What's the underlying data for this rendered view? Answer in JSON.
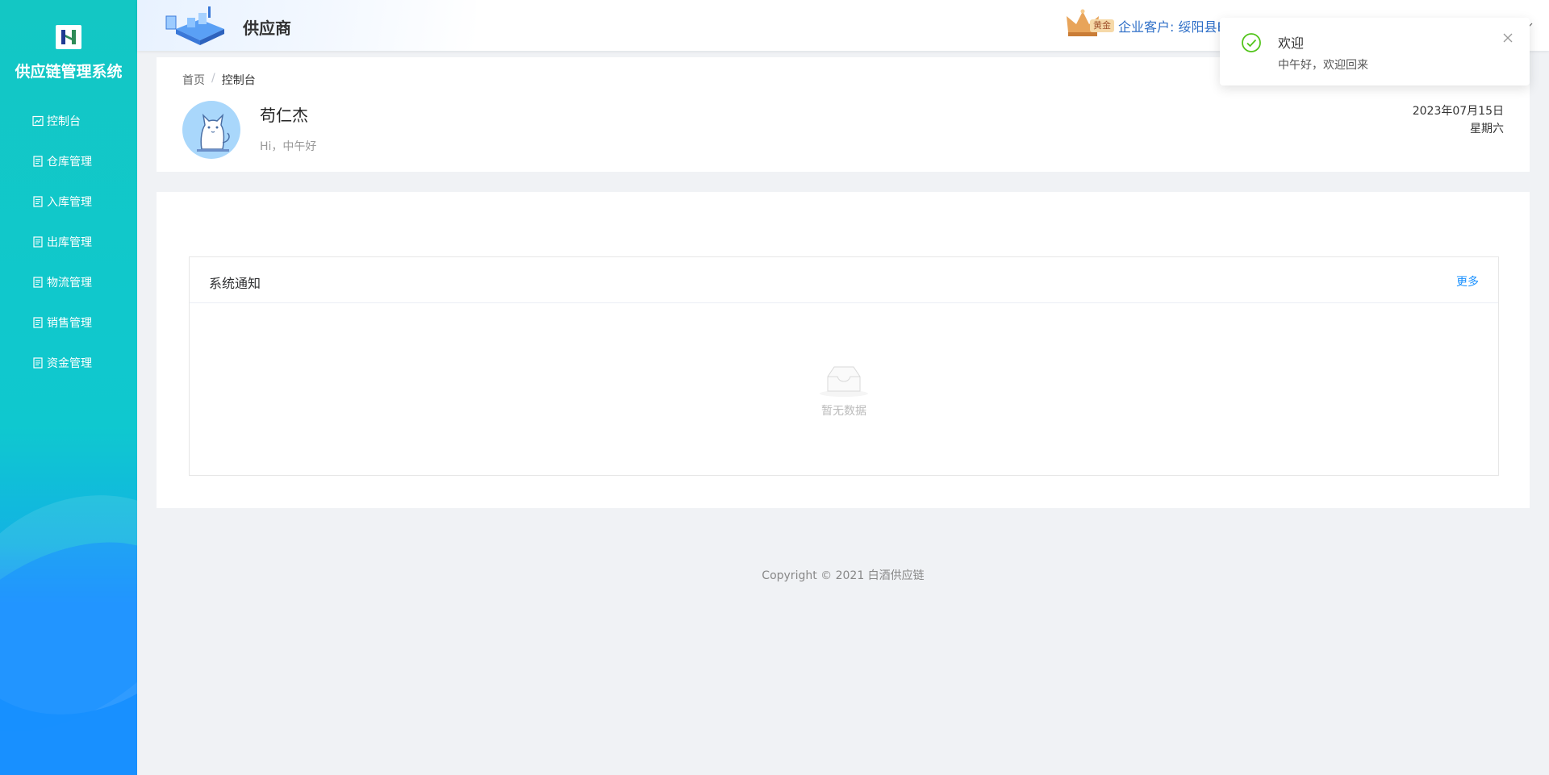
{
  "sidebar": {
    "system_title": "供应链管理系统",
    "items": [
      {
        "label": "控制台",
        "icon": "dashboard-icon"
      },
      {
        "label": "仓库管理",
        "icon": "document-icon"
      },
      {
        "label": "入库管理",
        "icon": "document-icon"
      },
      {
        "label": "出库管理",
        "icon": "document-icon"
      },
      {
        "label": "物流管理",
        "icon": "document-icon"
      },
      {
        "label": "销售管理",
        "icon": "document-icon"
      },
      {
        "label": "资金管理",
        "icon": "document-icon"
      }
    ]
  },
  "header": {
    "role": "供应商",
    "tier_badge": "黄金",
    "company": "企业客户: 绥阳县B"
  },
  "welcome": {
    "breadcrumb": {
      "home": "首页",
      "separator": "/",
      "current": "控制台"
    },
    "username": "苟仁杰",
    "greeting": "Hi，中午好",
    "date": "2023年07月15日",
    "weekday": "星期六"
  },
  "notice": {
    "title": "系统通知",
    "more": "更多",
    "empty_text": "暂无数据"
  },
  "footer": {
    "copyright": "Copyright © 2021 白酒供应链"
  },
  "toast": {
    "title": "欢迎",
    "message": "中午好，欢迎回来"
  },
  "colors": {
    "sidebar_top": "#13c7c4",
    "sidebar_bottom": "#1890ff",
    "accent": "#1890ff",
    "success": "#52c41a"
  }
}
